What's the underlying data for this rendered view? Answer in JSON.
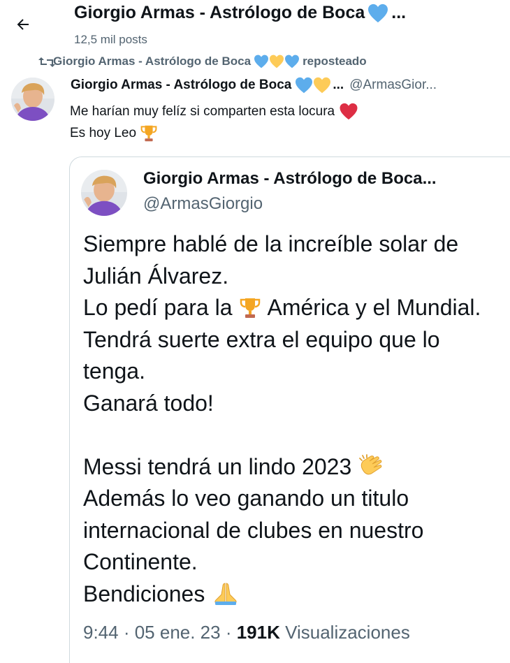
{
  "header": {
    "title": "Giorgio Armas - Astrólogo de Boca",
    "title_suffix": "...",
    "post_count": "12,5 mil posts"
  },
  "repost": {
    "name": "Giorgio Armas - Astrólogo de Boca",
    "label": "reposteado"
  },
  "tweet": {
    "name": "Giorgio Armas - Astrólogo de Boca",
    "name_suffix": "...",
    "handle": "@ArmasGior...",
    "lines": [
      "Me harían muy felíz si comparten esta locura",
      "Es hoy Leo"
    ]
  },
  "quote": {
    "name": "Giorgio Armas - Astrólogo de Boca...",
    "handle": "@ArmasGiorgio",
    "lines": [
      "Siempre hablé de la increíble solar de",
      "Julián Álvarez.",
      "Lo pedí para la",
      "América y el Mundial.",
      "Tendrá suerte extra el equipo que lo",
      "tenga.",
      "Ganará todo!",
      "",
      "Messi tendrá un lindo 2023",
      "Además lo veo ganando un titulo",
      "internacional de clubes en nuestro",
      "Continente.",
      "Bendiciones"
    ],
    "time": "9:44 · 05 ene. 23 · ",
    "views_count": "191K",
    "views_label": " Visualizaciones"
  },
  "colors": {
    "text": "#0f1419",
    "secondary": "#536471",
    "border": "#cfd9de",
    "heart_blue": "#5dadec",
    "heart_yellow": "#fdcb58",
    "heart_red": "#dd2e44",
    "trophy": "#f4a623"
  },
  "icons": {
    "back": "arrow-left-icon",
    "repost": "repost-icon",
    "heart_blue": "blue-heart-icon",
    "heart_yellow": "yellow-heart-icon",
    "heart_red": "red-heart-icon",
    "trophy": "trophy-icon",
    "clap": "clapping-hands-icon",
    "pray": "folded-hands-icon"
  }
}
